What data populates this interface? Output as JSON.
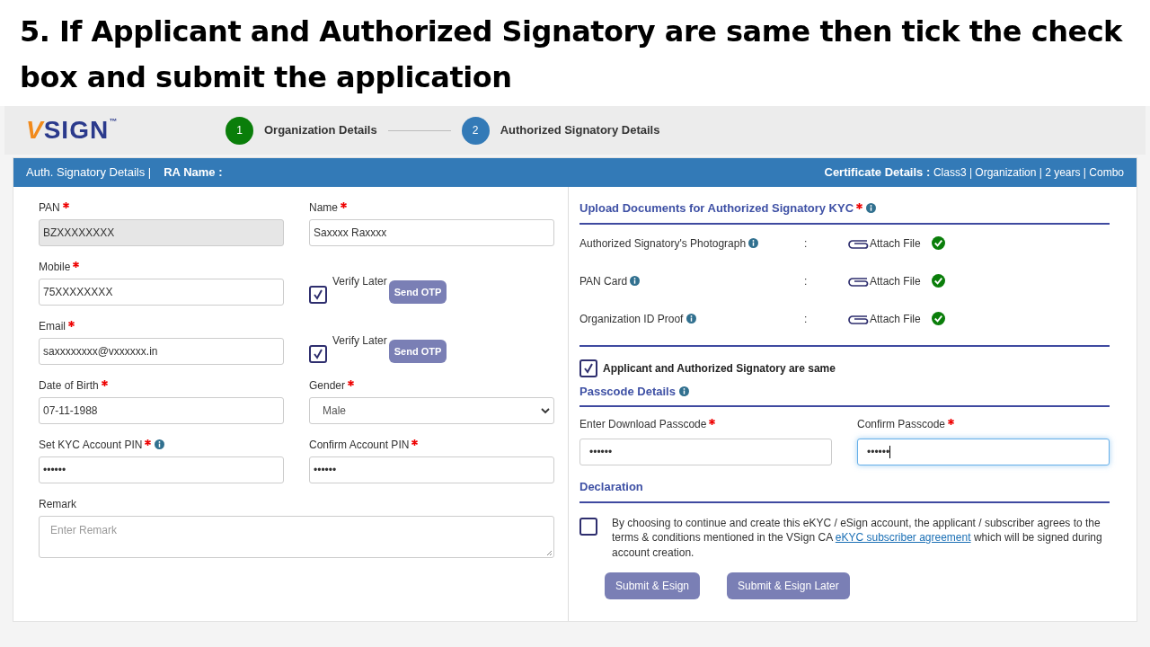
{
  "caption": "5. If Applicant and Authorized Signatory are same then tick the check box and submit the application",
  "logo": {
    "text": "VSIGN",
    "trademark": "™"
  },
  "steps": [
    {
      "number": "1",
      "label": "Organization Details",
      "completed": true
    },
    {
      "number": "2",
      "label": "Authorized Signatory Details",
      "completed": false
    }
  ],
  "bar": {
    "section": "Auth. Signatory Details |",
    "ra_label": "RA Name :",
    "cert_label": "Certificate Details :",
    "cert_value": "Class3 | Organization | 2 years | Combo"
  },
  "fields": [
    {
      "kind": "input",
      "label": "PAN",
      "required": true,
      "value": "BZXXXXXXXX",
      "disabled": true
    },
    {
      "kind": "input",
      "label": "Name",
      "required": true,
      "value": "Saxxxx Raxxxx",
      "disabled": false
    },
    {
      "kind": "input",
      "label": "Mobile",
      "required": true,
      "value": "75XXXXXXXX",
      "disabled": false
    },
    {
      "kind": "verify",
      "label": "Verify Later",
      "checked": true,
      "button": "Send OTP"
    },
    {
      "kind": "input",
      "label": "Email",
      "required": true,
      "value": "saxxxxxxxx@vxxxxxx.in",
      "disabled": false
    },
    {
      "kind": "verify",
      "label": "Verify Later",
      "checked": true,
      "button": "Send OTP"
    },
    {
      "kind": "input",
      "label": "Date of Birth",
      "required": true,
      "value": "07-11-1988",
      "disabled": false
    },
    {
      "kind": "select",
      "label": "Gender",
      "required": true,
      "value": "Male"
    },
    {
      "kind": "input",
      "label": "Set KYC Account PIN",
      "required": true,
      "info": true,
      "value": "••••••",
      "disabled": false
    },
    {
      "kind": "input",
      "label": "Confirm Account PIN",
      "required": true,
      "value": "••••••",
      "disabled": false
    },
    {
      "kind": "textarea",
      "label": "Remark",
      "placeholder": "Enter Remark"
    }
  ],
  "upload": {
    "title": "Upload Documents for Authorized Signatory KYC",
    "required": true,
    "info": true,
    "documents": [
      {
        "label": "Authorized Signatory's Photograph",
        "separator": ":",
        "attach": "Attach File",
        "uploaded": true
      },
      {
        "label": "PAN Card",
        "separator": ":",
        "attach": "Attach File",
        "uploaded": true
      },
      {
        "label": "Organization ID Proof",
        "separator": ":",
        "attach": "Attach File",
        "uploaded": true
      }
    ]
  },
  "same_signatory": {
    "label": "Applicant and Authorized Signatory are same",
    "checked": true
  },
  "passcode": {
    "title": "Passcode Details",
    "info": true,
    "fields": [
      {
        "label": "Enter Download Passcode",
        "required": true,
        "value": "••••••",
        "focused": false
      },
      {
        "label": "Confirm Passcode",
        "required": true,
        "value": "••••••",
        "focused": true
      }
    ]
  },
  "declaration": {
    "title": "Declaration",
    "checked": false,
    "text_before": "By choosing to continue and create this eKYC / eSign account, the applicant / subscriber agrees to the terms & conditions mentioned in the VSign CA",
    "link": "eKYC subscriber agreement",
    "text_after": "which will be signed during account creation."
  },
  "buttons": [
    "Submit & Esign",
    "Submit & Esign Later"
  ]
}
